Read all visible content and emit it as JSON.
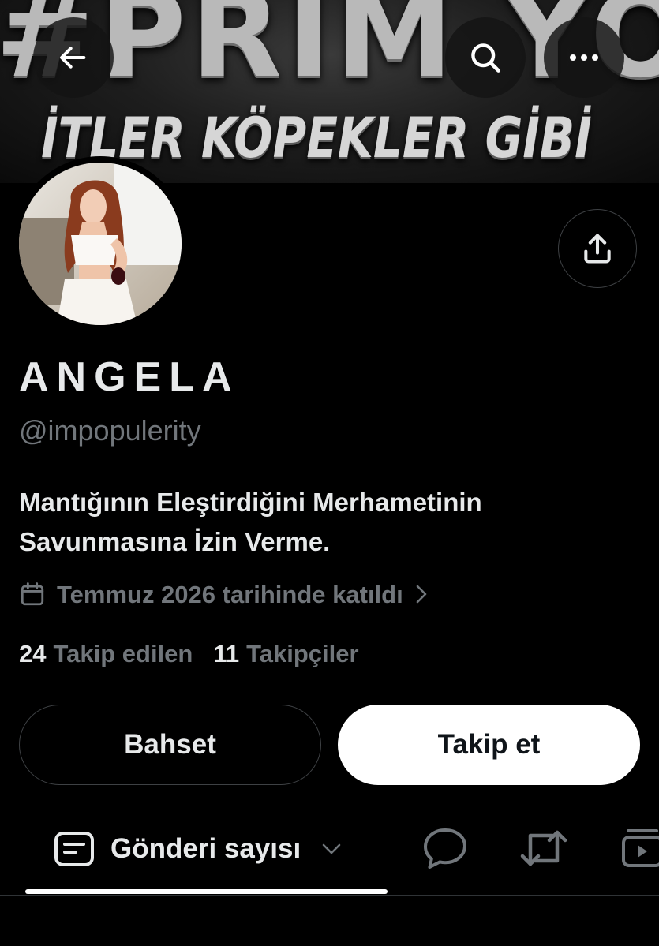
{
  "banner": {
    "line1": "#PRIM YOK",
    "line2": "İTLER KÖPEKLER GİBİ"
  },
  "header": {
    "back_icon": "arrow-left-icon",
    "search_icon": "search-icon",
    "more_icon": "more-horizontal-icon"
  },
  "profile": {
    "display_name": "ANGELA",
    "handle": "@impopulerity",
    "bio_line1": "Mantığının Eleştirdiğini Merhametinin",
    "bio_line2": "Savunmasına İzin Verme.",
    "joined": "Temmuz 2026 tarihinde katıldı",
    "following_count": "24",
    "following_label": "Takip edilen",
    "followers_count": "11",
    "followers_label": "Takipçiler"
  },
  "actions": {
    "mention_label": "Bahset",
    "follow_label": "Takip et"
  },
  "tabs": {
    "posts_label": "Gönderi sayısı",
    "icons": [
      "doc-icon",
      "chevron-down-icon",
      "reply-icon",
      "repost-icon",
      "media-icon"
    ]
  },
  "colors": {
    "background": "#000000",
    "primary_text": "#e7e9ea",
    "secondary_text": "#71767b",
    "border": "#3e4144",
    "follow_bg": "#ffffff"
  }
}
